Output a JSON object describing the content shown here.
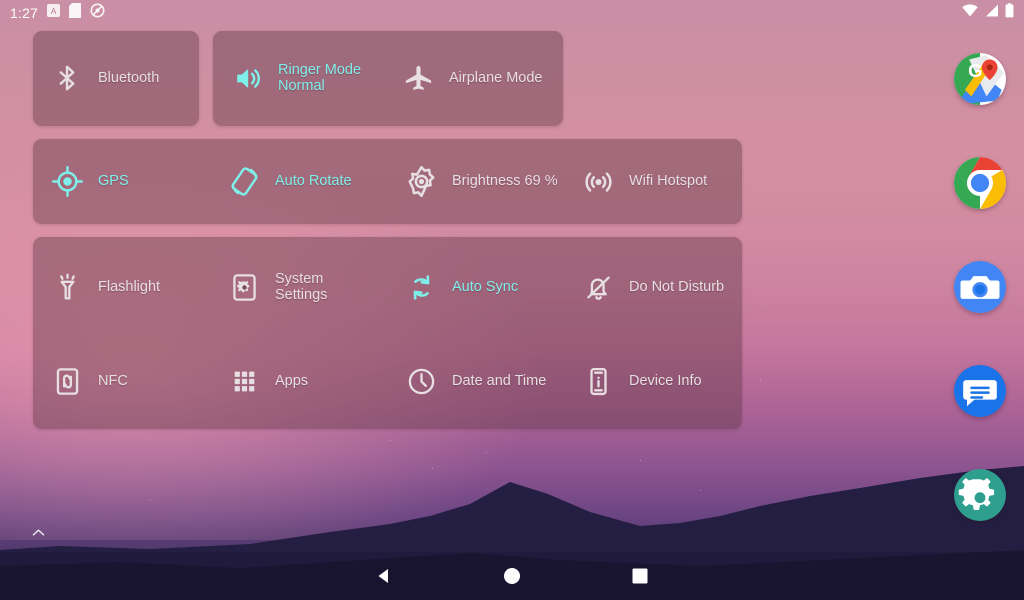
{
  "statusbar": {
    "clock": "1:27",
    "left_icons": [
      {
        "name": "alarm-badge-icon",
        "glyph": "A"
      },
      {
        "name": "sd-card-icon",
        "glyph": "sd"
      },
      {
        "name": "no-sync-icon",
        "glyph": "slash-circle"
      }
    ],
    "right_icons": [
      {
        "name": "wifi-icon",
        "glyph": "wifi"
      },
      {
        "name": "cellular-signal-icon",
        "glyph": "signal"
      },
      {
        "name": "battery-icon",
        "glyph": "battery"
      }
    ]
  },
  "colors": {
    "accent_active": "#7fefe9",
    "label_inactive": "#e7dfe1",
    "panel_bg": "rgba(95,55,68,.42)",
    "wallpaper_top": "#c98fa4",
    "wallpaper_bottom": "#2e2a4e"
  },
  "quick_settings": {
    "panels": [
      {
        "id": "panel-1a",
        "tiles": [
          {
            "label": "Bluetooth",
            "icon": "bluetooth-icon",
            "active": false
          }
        ]
      },
      {
        "id": "panel-1b",
        "tiles": [
          {
            "label": "Ringer Mode\nNormal",
            "icon": "volume-up-icon",
            "active": true
          },
          {
            "label": "Airplane Mode",
            "icon": "airplane-icon",
            "active": false
          }
        ]
      },
      {
        "id": "panel-2",
        "tiles": [
          {
            "label": "GPS",
            "icon": "location-crosshair-icon",
            "active": true
          },
          {
            "label": "Auto Rotate",
            "icon": "screen-rotation-icon",
            "active": true
          },
          {
            "label": "Brightness 69 %",
            "icon": "brightness-icon",
            "active": false
          },
          {
            "label": "Wifi Hotspot",
            "icon": "hotspot-icon",
            "active": false
          }
        ]
      },
      {
        "id": "panel-3",
        "tiles": [
          {
            "label": "Flashlight",
            "icon": "flashlight-icon",
            "active": false
          },
          {
            "label": "System\nSettings",
            "icon": "settings-gear-icon",
            "active": false
          },
          {
            "label": "Auto Sync",
            "icon": "sync-icon",
            "active": true
          },
          {
            "label": "Do Not Disturb",
            "icon": "bell-off-icon",
            "active": false
          },
          {
            "label": "NFC",
            "icon": "nfc-icon",
            "active": false
          },
          {
            "label": "Apps",
            "icon": "apps-grid-icon",
            "active": false
          },
          {
            "label": "Date and Time",
            "icon": "clock-icon",
            "active": false
          },
          {
            "label": "Device Info",
            "icon": "device-info-icon",
            "active": false
          }
        ]
      }
    ]
  },
  "dock": {
    "apps": [
      {
        "name": "maps-app-icon",
        "label": "Maps"
      },
      {
        "name": "chrome-app-icon",
        "label": "Chrome"
      },
      {
        "name": "camera-app-icon",
        "label": "Camera"
      },
      {
        "name": "messages-app-icon",
        "label": "Messages"
      },
      {
        "name": "settings-app-icon",
        "label": "Settings"
      }
    ]
  },
  "navbar": {
    "buttons": [
      {
        "name": "back-button",
        "glyph": "triangle-left"
      },
      {
        "name": "home-button",
        "glyph": "circle"
      },
      {
        "name": "recents-button",
        "glyph": "square"
      }
    ]
  },
  "drawer_handle": {
    "name": "app-drawer-chevron-up-icon"
  }
}
